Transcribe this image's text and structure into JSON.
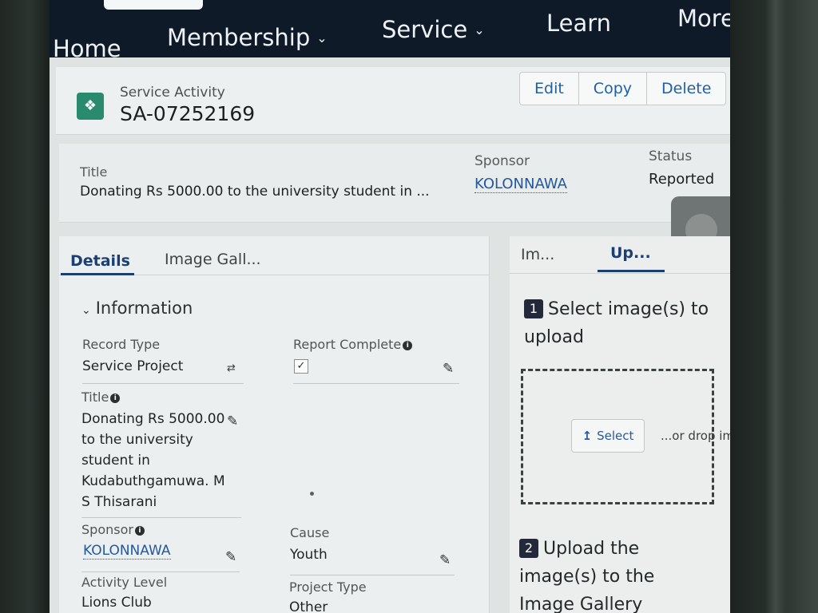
{
  "nav": {
    "items": [
      {
        "label": "Home",
        "has_menu": false
      },
      {
        "label": "Membership",
        "has_menu": true
      },
      {
        "label": "Service",
        "has_menu": true
      },
      {
        "label": "Learn",
        "has_menu": false
      },
      {
        "label": "More",
        "has_menu": false
      }
    ]
  },
  "record": {
    "object_type": "Service Activity",
    "id": "SA-07252169",
    "icon": "service-activity-icon",
    "actions": [
      "Edit",
      "Copy",
      "Delete"
    ]
  },
  "highlights": {
    "title_label": "Title",
    "title_value": "Donating Rs 5000.00 to the university student in ...",
    "sponsor_label": "Sponsor",
    "sponsor_value": "KOLONNAWA",
    "status_label": "Status",
    "status_value": "Reported"
  },
  "left_tabs": [
    "Details",
    "Image Gall..."
  ],
  "details": {
    "section": "Information",
    "record_type_label": "Record Type",
    "record_type_value": "Service Project",
    "report_complete_label": "Report Complete",
    "report_complete_checked": true,
    "title_label": "Title",
    "title_lines": [
      "Donating Rs 5000.00",
      "to the university",
      "student in",
      "Kudabuthgamuwa. M",
      "S Thisarani"
    ],
    "sponsor_label": "Sponsor",
    "sponsor_value": "KOLONNAWA",
    "cause_label": "Cause",
    "cause_value": "Youth",
    "activity_level_label": "Activity Level",
    "activity_level_value": "Lions Club",
    "project_type_label": "Project Type",
    "project_type_value": "Other"
  },
  "right_tabs": [
    "Im...",
    "Up..."
  ],
  "upload": {
    "step1_number": "1",
    "step1_lines": [
      "Select image(s) to",
      "upload"
    ],
    "select_label": "Select",
    "drop_text": "...or drop images",
    "step2_number": "2",
    "step2_lines": [
      "Upload the",
      "image(s) to the",
      "Image Gallery"
    ]
  },
  "colors": {
    "nav_bg": "#0f1a28",
    "link": "#23599c",
    "active_tab": "#1b3f73",
    "record_icon": "#2a8a6d"
  }
}
